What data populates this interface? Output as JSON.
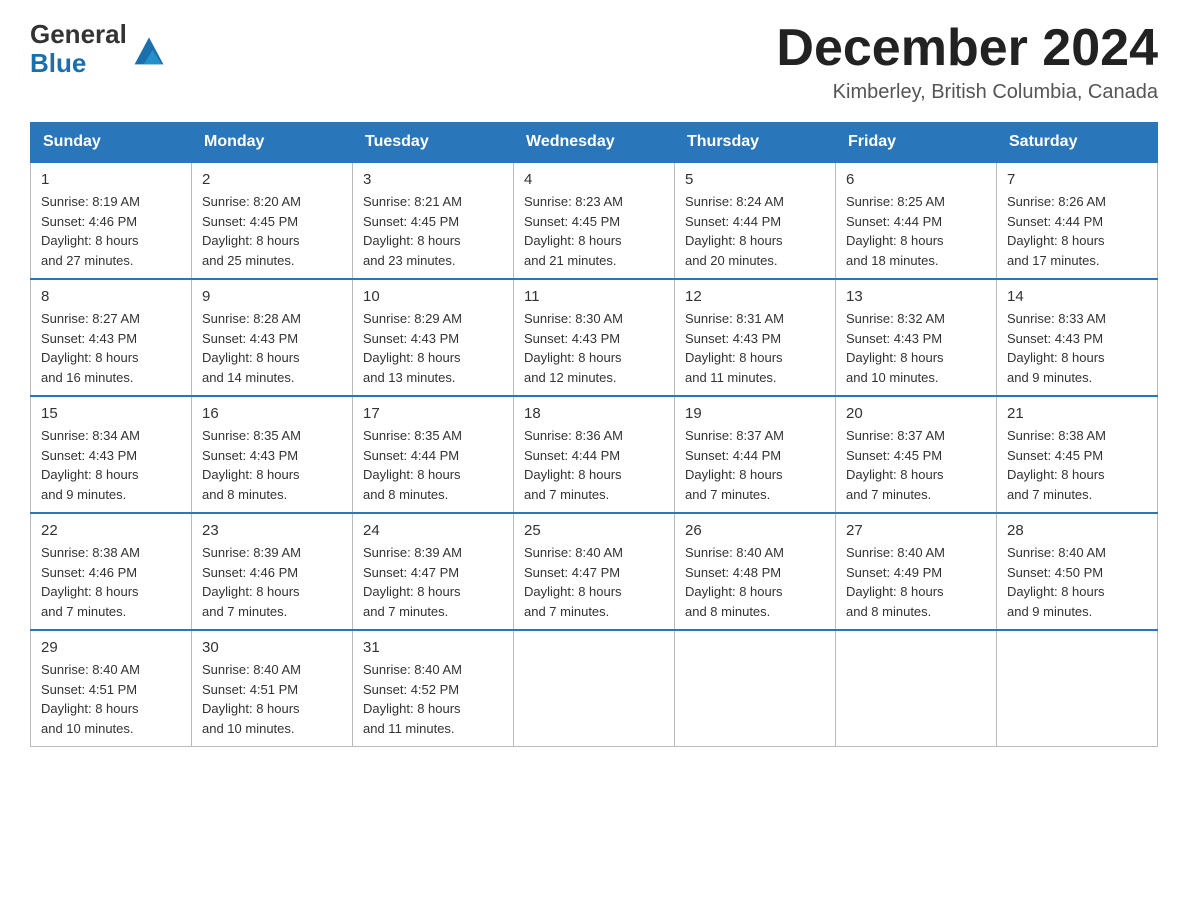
{
  "header": {
    "logo_general": "General",
    "logo_blue": "Blue",
    "month_year": "December 2024",
    "location": "Kimberley, British Columbia, Canada"
  },
  "days_of_week": [
    "Sunday",
    "Monday",
    "Tuesday",
    "Wednesday",
    "Thursday",
    "Friday",
    "Saturday"
  ],
  "weeks": [
    [
      {
        "day": "1",
        "sunrise": "8:19 AM",
        "sunset": "4:46 PM",
        "daylight": "8 hours and 27 minutes."
      },
      {
        "day": "2",
        "sunrise": "8:20 AM",
        "sunset": "4:45 PM",
        "daylight": "8 hours and 25 minutes."
      },
      {
        "day": "3",
        "sunrise": "8:21 AM",
        "sunset": "4:45 PM",
        "daylight": "8 hours and 23 minutes."
      },
      {
        "day": "4",
        "sunrise": "8:23 AM",
        "sunset": "4:45 PM",
        "daylight": "8 hours and 21 minutes."
      },
      {
        "day": "5",
        "sunrise": "8:24 AM",
        "sunset": "4:44 PM",
        "daylight": "8 hours and 20 minutes."
      },
      {
        "day": "6",
        "sunrise": "8:25 AM",
        "sunset": "4:44 PM",
        "daylight": "8 hours and 18 minutes."
      },
      {
        "day": "7",
        "sunrise": "8:26 AM",
        "sunset": "4:44 PM",
        "daylight": "8 hours and 17 minutes."
      }
    ],
    [
      {
        "day": "8",
        "sunrise": "8:27 AM",
        "sunset": "4:43 PM",
        "daylight": "8 hours and 16 minutes."
      },
      {
        "day": "9",
        "sunrise": "8:28 AM",
        "sunset": "4:43 PM",
        "daylight": "8 hours and 14 minutes."
      },
      {
        "day": "10",
        "sunrise": "8:29 AM",
        "sunset": "4:43 PM",
        "daylight": "8 hours and 13 minutes."
      },
      {
        "day": "11",
        "sunrise": "8:30 AM",
        "sunset": "4:43 PM",
        "daylight": "8 hours and 12 minutes."
      },
      {
        "day": "12",
        "sunrise": "8:31 AM",
        "sunset": "4:43 PM",
        "daylight": "8 hours and 11 minutes."
      },
      {
        "day": "13",
        "sunrise": "8:32 AM",
        "sunset": "4:43 PM",
        "daylight": "8 hours and 10 minutes."
      },
      {
        "day": "14",
        "sunrise": "8:33 AM",
        "sunset": "4:43 PM",
        "daylight": "8 hours and 9 minutes."
      }
    ],
    [
      {
        "day": "15",
        "sunrise": "8:34 AM",
        "sunset": "4:43 PM",
        "daylight": "8 hours and 9 minutes."
      },
      {
        "day": "16",
        "sunrise": "8:35 AM",
        "sunset": "4:43 PM",
        "daylight": "8 hours and 8 minutes."
      },
      {
        "day": "17",
        "sunrise": "8:35 AM",
        "sunset": "4:44 PM",
        "daylight": "8 hours and 8 minutes."
      },
      {
        "day": "18",
        "sunrise": "8:36 AM",
        "sunset": "4:44 PM",
        "daylight": "8 hours and 7 minutes."
      },
      {
        "day": "19",
        "sunrise": "8:37 AM",
        "sunset": "4:44 PM",
        "daylight": "8 hours and 7 minutes."
      },
      {
        "day": "20",
        "sunrise": "8:37 AM",
        "sunset": "4:45 PM",
        "daylight": "8 hours and 7 minutes."
      },
      {
        "day": "21",
        "sunrise": "8:38 AM",
        "sunset": "4:45 PM",
        "daylight": "8 hours and 7 minutes."
      }
    ],
    [
      {
        "day": "22",
        "sunrise": "8:38 AM",
        "sunset": "4:46 PM",
        "daylight": "8 hours and 7 minutes."
      },
      {
        "day": "23",
        "sunrise": "8:39 AM",
        "sunset": "4:46 PM",
        "daylight": "8 hours and 7 minutes."
      },
      {
        "day": "24",
        "sunrise": "8:39 AM",
        "sunset": "4:47 PM",
        "daylight": "8 hours and 7 minutes."
      },
      {
        "day": "25",
        "sunrise": "8:40 AM",
        "sunset": "4:47 PM",
        "daylight": "8 hours and 7 minutes."
      },
      {
        "day": "26",
        "sunrise": "8:40 AM",
        "sunset": "4:48 PM",
        "daylight": "8 hours and 8 minutes."
      },
      {
        "day": "27",
        "sunrise": "8:40 AM",
        "sunset": "4:49 PM",
        "daylight": "8 hours and 8 minutes."
      },
      {
        "day": "28",
        "sunrise": "8:40 AM",
        "sunset": "4:50 PM",
        "daylight": "8 hours and 9 minutes."
      }
    ],
    [
      {
        "day": "29",
        "sunrise": "8:40 AM",
        "sunset": "4:51 PM",
        "daylight": "8 hours and 10 minutes."
      },
      {
        "day": "30",
        "sunrise": "8:40 AM",
        "sunset": "4:51 PM",
        "daylight": "8 hours and 10 minutes."
      },
      {
        "day": "31",
        "sunrise": "8:40 AM",
        "sunset": "4:52 PM",
        "daylight": "8 hours and 11 minutes."
      },
      null,
      null,
      null,
      null
    ]
  ]
}
